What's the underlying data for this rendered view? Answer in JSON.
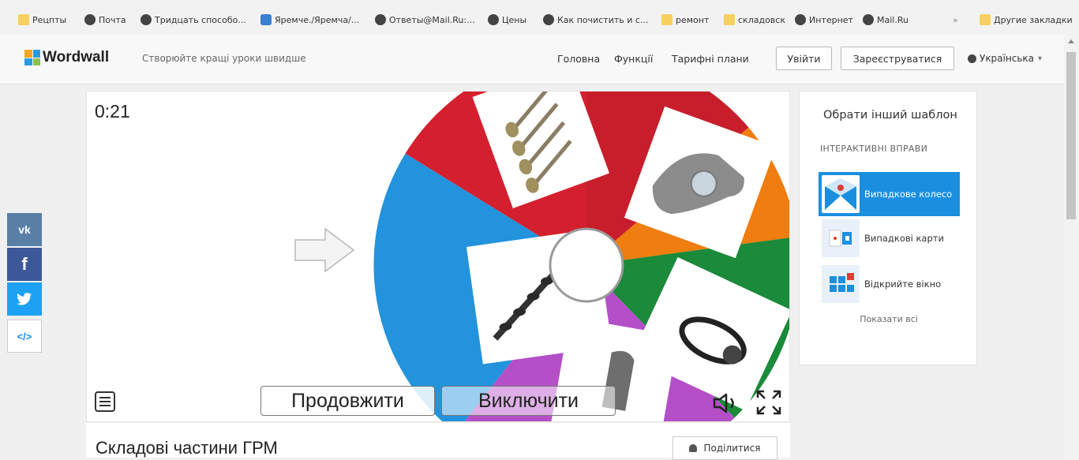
{
  "bookmarks": [
    {
      "label": "Рецпты",
      "icon": "folder-icon"
    },
    {
      "label": "Почта",
      "icon": "globe-icon"
    },
    {
      "label": "Тридцать способо...",
      "icon": "globe-icon"
    },
    {
      "label": "Яремче./Яремча/...",
      "icon": "site-icon"
    },
    {
      "label": "Ответы@Mail.Ru:...",
      "icon": "globe-icon"
    },
    {
      "label": "Цены",
      "icon": "globe-icon"
    },
    {
      "label": "Как почистить и с...",
      "icon": "globe-icon"
    },
    {
      "label": "ремонт",
      "icon": "folder-icon"
    },
    {
      "label": "складовск",
      "icon": "folder-icon"
    },
    {
      "label": "Интернет",
      "icon": "globe-icon"
    },
    {
      "label": "Mail.Ru",
      "icon": "globe-icon"
    }
  ],
  "bookmarks_more": "»",
  "bookmarks_other": "Другие закладки",
  "header": {
    "brand": "Wordwall",
    "tagline": "Створюйте кращі уроки швидше",
    "nav": [
      "Головна",
      "Функції",
      "Тарифні плани"
    ],
    "login": "Увійти",
    "register": "Зареєструватися",
    "language": "Українська",
    "language_caret": "▾"
  },
  "game": {
    "timer": "0:21",
    "continue_label": "Продовжити",
    "exclude_label": "Виключити",
    "segment_images": [
      "valves",
      "rocker-arm",
      "timing-belt",
      "valve-lifter",
      "camshaft"
    ],
    "colors": {
      "red": "#d4202e",
      "orange": "#ef7d0f",
      "green": "#1b8a3a",
      "purple": "#b44fc8",
      "blue": "#2293dc"
    }
  },
  "activity": {
    "title": "Складові частини ГРМ",
    "share_label": "Поділитися"
  },
  "sidebar": {
    "title": "Обрати інший шаблон",
    "section": "ІНТЕРАКТИВНІ ВПРАВИ",
    "templates": [
      {
        "label": "Випадкове колесо",
        "active": true
      },
      {
        "label": "Випадкові карти",
        "active": false
      },
      {
        "label": "Відкрийте вікно",
        "active": false
      }
    ],
    "show_all": "Показати всі"
  },
  "social": [
    {
      "label": "vk",
      "icon": "vk-icon",
      "color": "#5a7fa6"
    },
    {
      "label": "f",
      "icon": "facebook-icon",
      "color": "#3b5998"
    },
    {
      "label": "twitter",
      "icon": "twitter-icon",
      "color": "#1da1f2"
    },
    {
      "label": "</>",
      "icon": "embed-icon",
      "color": "#ffffff"
    }
  ],
  "accent": "#1a8fe0"
}
